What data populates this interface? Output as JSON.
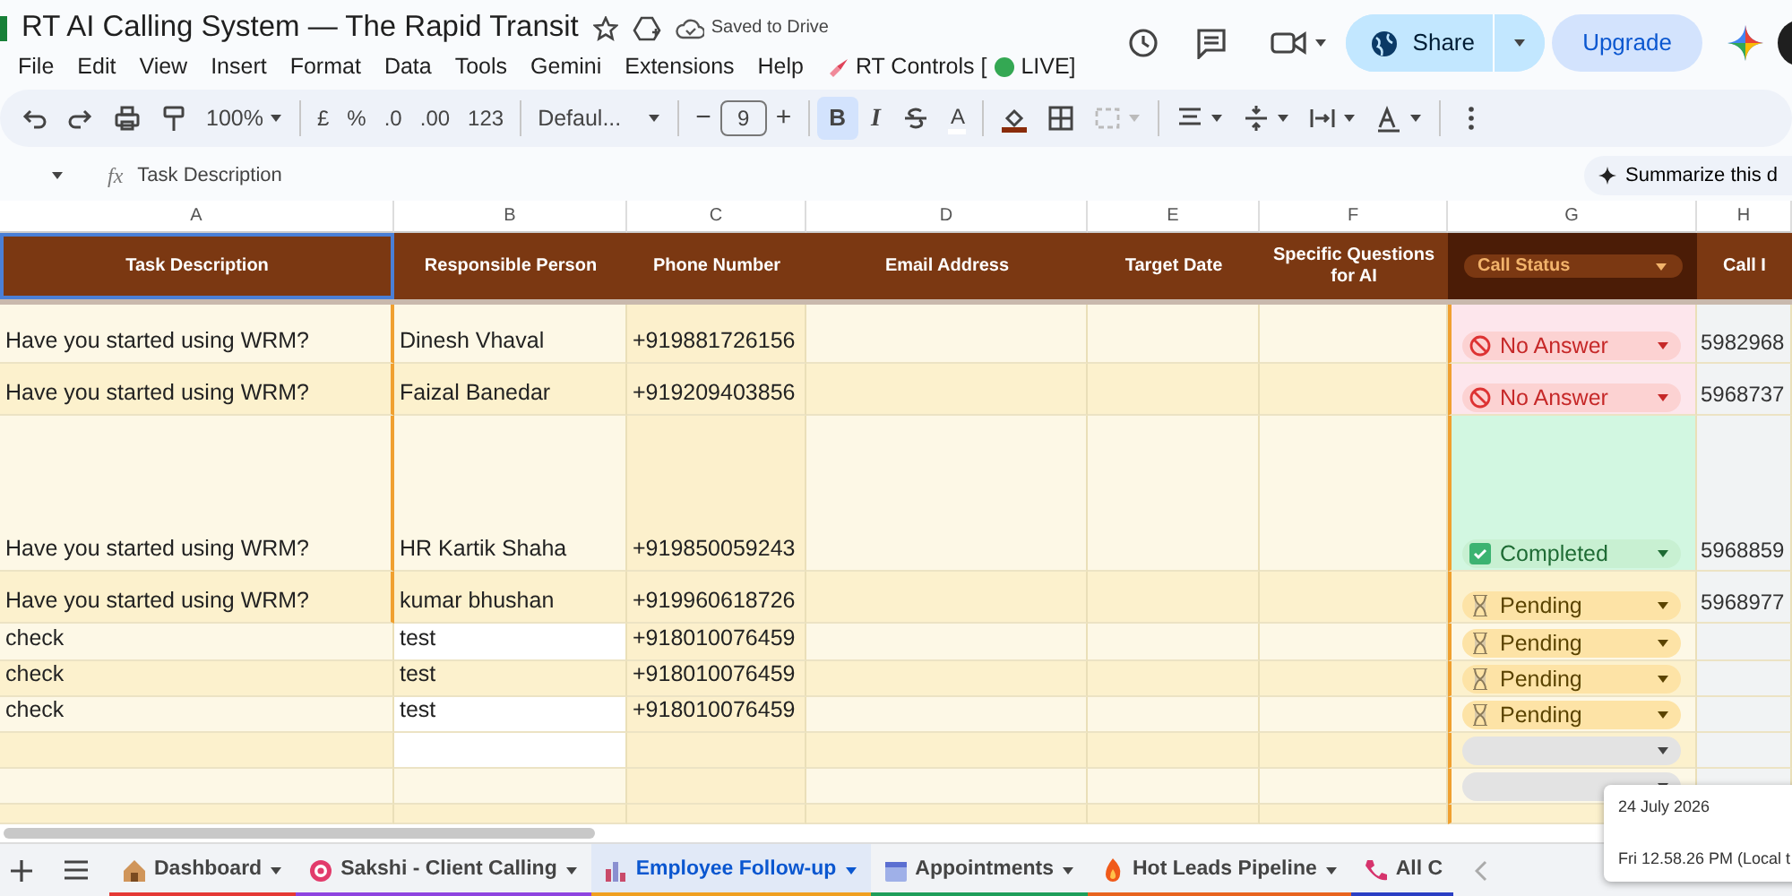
{
  "document": {
    "title": "RT AI Calling System — The Rapid Transit",
    "save_status": "Saved to Drive"
  },
  "menu": [
    "File",
    "Edit",
    "View",
    "Insert",
    "Format",
    "Data",
    "Tools",
    "Gemini",
    "Extensions",
    "Help"
  ],
  "addon_menu": {
    "label_before": "RT Controls [",
    "label_after": "LIVE]"
  },
  "share": {
    "label": "Share"
  },
  "upgrade": {
    "label": "Upgrade"
  },
  "toolbar": {
    "zoom": "100%",
    "currency": "£",
    "percent": "%",
    "decrease_decimals": ".0",
    "increase_decimals": ".00",
    "number_format": "123",
    "font": "Defaul...",
    "font_size_minus": "−",
    "font_size": "9",
    "font_size_plus": "+",
    "bold": {
      "label": "B",
      "selected": true
    },
    "italic": {
      "label": "I",
      "selected": false
    },
    "text_color": "A"
  },
  "formula_bar": {
    "fx": "fx",
    "content": "Task Description"
  },
  "summarize": {
    "label": "Summarize this d"
  },
  "columns": [
    "A",
    "B",
    "C",
    "D",
    "E",
    "F",
    "G",
    "H"
  ],
  "header": [
    {
      "text": "Task Description",
      "selected": true
    },
    {
      "text": "Responsible Person",
      "selected": false
    },
    {
      "text": "Phone Number",
      "selected": false
    },
    {
      "text": "Email Address",
      "selected": false
    },
    {
      "text": "Target Date",
      "selected": false
    },
    {
      "text": "Specific Questions for AI",
      "selected": false
    },
    {
      "text": "Call Status",
      "selected": false
    },
    {
      "text": "Call I",
      "selected": false
    }
  ],
  "rows": [
    {
      "task": "Have you started using WRM?",
      "person": "Dinesh Vhaval",
      "phone": "+919881726156",
      "status": {
        "kind": "no_answer",
        "label": "No Answer"
      },
      "call_id": "5982968"
    },
    {
      "task": "Have you started using WRM?",
      "person": "Faizal Banedar",
      "phone": "+919209403856",
      "status": {
        "kind": "no_answer",
        "label": "No Answer"
      },
      "call_id": "5968737"
    },
    {
      "task": "Have you started using WRM?",
      "person": "HR Kartik Shaha",
      "phone": "+919850059243",
      "status": {
        "kind": "completed",
        "label": "Completed"
      },
      "call_id": "5968859"
    },
    {
      "task": "Have you started using WRM?",
      "person": "kumar bhushan",
      "phone": "+919960618726",
      "status": {
        "kind": "pending",
        "label": "Pending"
      },
      "call_id": "5968977"
    },
    {
      "task": "check",
      "person": "test",
      "phone": "+918010076459",
      "status": {
        "kind": "pending",
        "label": "Pending"
      }
    },
    {
      "task": "check",
      "person": "test",
      "phone": "+918010076459",
      "status": {
        "kind": "pending",
        "label": "Pending"
      }
    },
    {
      "task": "check",
      "person": "test",
      "phone": "+918010076459",
      "status": {
        "kind": "pending",
        "label": "Pending"
      }
    },
    {
      "status": {
        "kind": "empty"
      }
    },
    {
      "status": {
        "kind": "empty"
      }
    },
    {}
  ],
  "tooltip": {
    "date": "24 July 2026",
    "time": "Fri 12.58.26 PM (Local t"
  },
  "sheet_tabs": [
    {
      "label": "Dashboard",
      "color": "#e53935",
      "selected": false
    },
    {
      "label": "Sakshi - Client Calling",
      "color": "#8e44e0",
      "selected": false
    },
    {
      "label": "Employee Follow-up",
      "color": "#f0a020",
      "selected": true
    },
    {
      "label": "Appointments",
      "color": "#1e9e5a",
      "selected": false
    },
    {
      "label": "Hot Leads Pipeline",
      "color": "#e8641e",
      "selected": false
    },
    {
      "label": "All C",
      "color": "#2b3fc4",
      "selected": false
    }
  ]
}
